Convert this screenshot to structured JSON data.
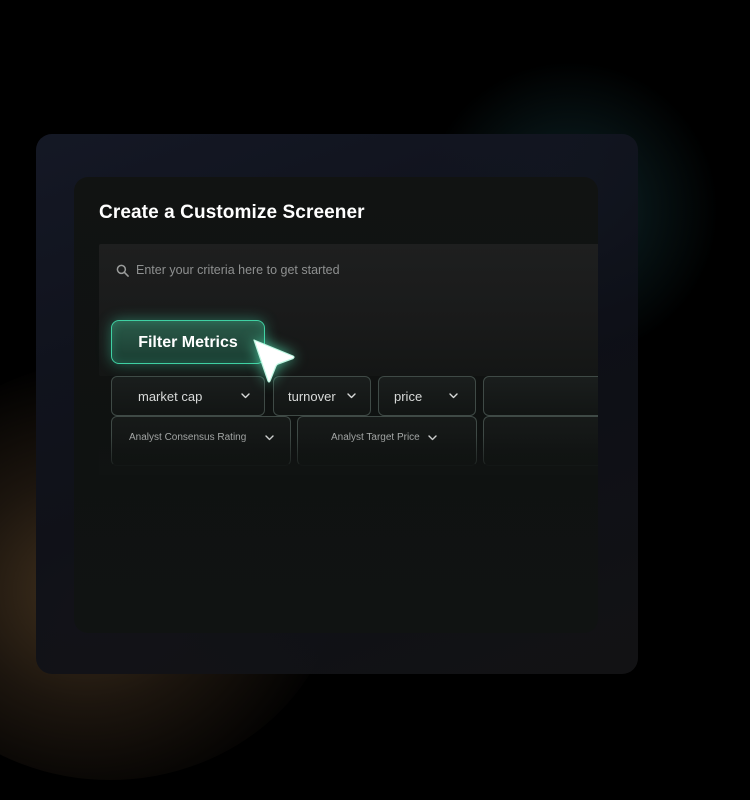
{
  "screener": {
    "title": "Create a Customize Screener",
    "search": {
      "placeholder": "Enter your criteria here to get started",
      "icon": "search-icon"
    },
    "filter_button": {
      "label": "Filter Metrics"
    },
    "metric_chips_row1": [
      {
        "label": "market cap"
      },
      {
        "label": "turnover"
      },
      {
        "label": "price"
      },
      {
        "label": ""
      }
    ],
    "metric_chips_row2": [
      {
        "label": "Analyst Consensus Rating"
      },
      {
        "label": "Analyst Target Price"
      },
      {
        "label": ""
      }
    ]
  },
  "colors": {
    "accent": "#3fd1a3",
    "background": "#000000",
    "card": "#111312",
    "text": "#ffffff"
  }
}
